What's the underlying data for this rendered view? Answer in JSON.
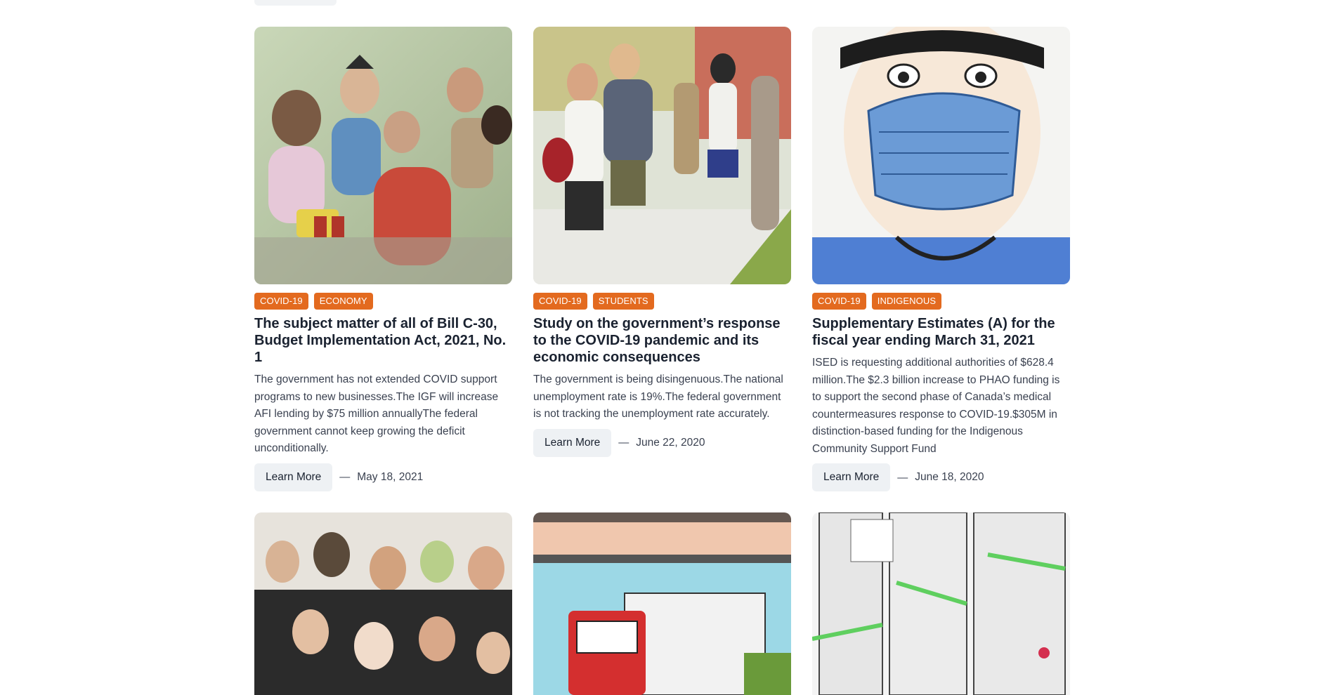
{
  "articles": [
    {
      "tags": [
        "COVID-19",
        "ECONOMY"
      ],
      "title": "The subject matter of all of Bill C-30, Budget Implementation Act, 2021, No. 1",
      "summary": "The government has not extended COVID support programs to new businesses.The IGF will increase AFI lending by $75 million annuallyThe federal government cannot keep growing the deficit unconditionally.",
      "button": "Learn More",
      "date": "May 18, 2021"
    },
    {
      "tags": [
        "COVID-19",
        "STUDENTS"
      ],
      "title": "Study on the government’s response to the COVID-19 pandemic and its economic consequences",
      "summary": "The government is being disingenuous.The national unemployment rate is 19%.The federal government is not tracking the unemployment rate accurately.",
      "button": "Learn More",
      "date": "June 22, 2020"
    },
    {
      "tags": [
        "COVID-19",
        "INDIGENOUS"
      ],
      "title": "Supplementary Estimates (A) for the fiscal year ending March 31, 2021",
      "summary": "ISED is requesting additional authorities of $628.4 million.The $2.3 billion increase to PHAO funding is to support the second phase of Canada’s medical countermeasures response to COVID-19.$305M in distinction-based funding for the Indigenous Community Support Fund",
      "button": "Learn More",
      "date": "June 18, 2020"
    }
  ],
  "separator": "—",
  "colors": {
    "tag": "#e36a1f",
    "button_bg": "#eef1f4"
  }
}
